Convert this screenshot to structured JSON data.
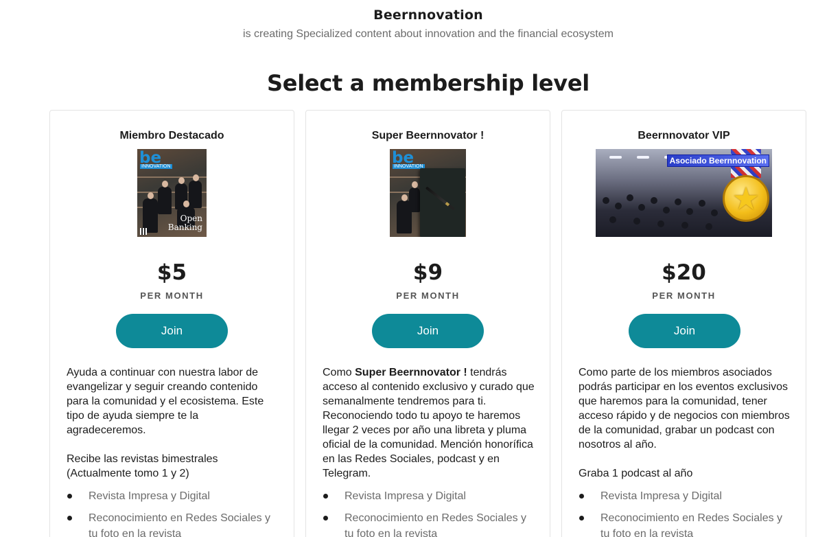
{
  "header": {
    "creator_name": "Beernnovation",
    "tagline": "is creating Specialized content about innovation and the financial ecosystem",
    "heading": "Select a membership level"
  },
  "tiers": [
    {
      "name": "Miembro Destacado",
      "price": "$5",
      "period": "PER MONTH",
      "join_label": "Join",
      "image": {
        "logo": "be",
        "logo_sub": "INNOVATION",
        "cover_text_1": "Open",
        "cover_text_2": "Banking"
      },
      "description_1": "Ayuda a continuar con nuestra labor de evangelizar y seguir creando contenido para la comunidad y el ecosistema. Este tipo de ayuda siempre te la agradeceremos.",
      "description_2": "Recibe las revistas bimestrales (Actualmente tomo 1 y 2)",
      "benefits": [
        "Revista Impresa y Digital",
        "Reconocimiento en Redes Sociales y tu foto en la revista"
      ]
    },
    {
      "name": "Super Beernnovator !",
      "price": "$9",
      "period": "PER MONTH",
      "join_label": "Join",
      "image": {
        "logo": "be",
        "logo_sub": "INNOVATION"
      },
      "description_pre": "Como ",
      "description_bold": "Super Beernnovator !",
      "description_post": " tendrás acceso al contenido exclusivo y curado que semanalmente tendremos para ti. Reconociendo todo tu apoyo te haremos llegar 2 veces por año una libreta y pluma oficial de la comunidad. Mención honorífica en las Redes Sociales, podcast y en Telegram.",
      "benefits": [
        "Revista Impresa y Digital",
        "Reconocimiento en Redes Sociales y tu foto en la revista"
      ]
    },
    {
      "name": "Beernnovator VIP",
      "price": "$20",
      "period": "PER MONTH",
      "join_label": "Join",
      "image": {
        "banner": "Asociado Beernnovation"
      },
      "description_1": "Como parte de los miembros asociados podrás participar en los eventos exclusivos que haremos para la comunidad, tener acceso rápido y de negocios con miembros de la comunidad, grabar un podcast con nosotros al año.",
      "description_2": "Graba 1 podcast al año",
      "benefits": [
        "Revista Impresa y Digital",
        "Reconocimiento en Redes Sociales y tu foto en la revista"
      ]
    }
  ],
  "colors": {
    "accent": "#0e8a98",
    "text": "#1c1c1c",
    "muted": "#6b6b6b",
    "border": "#e3e3e3"
  }
}
